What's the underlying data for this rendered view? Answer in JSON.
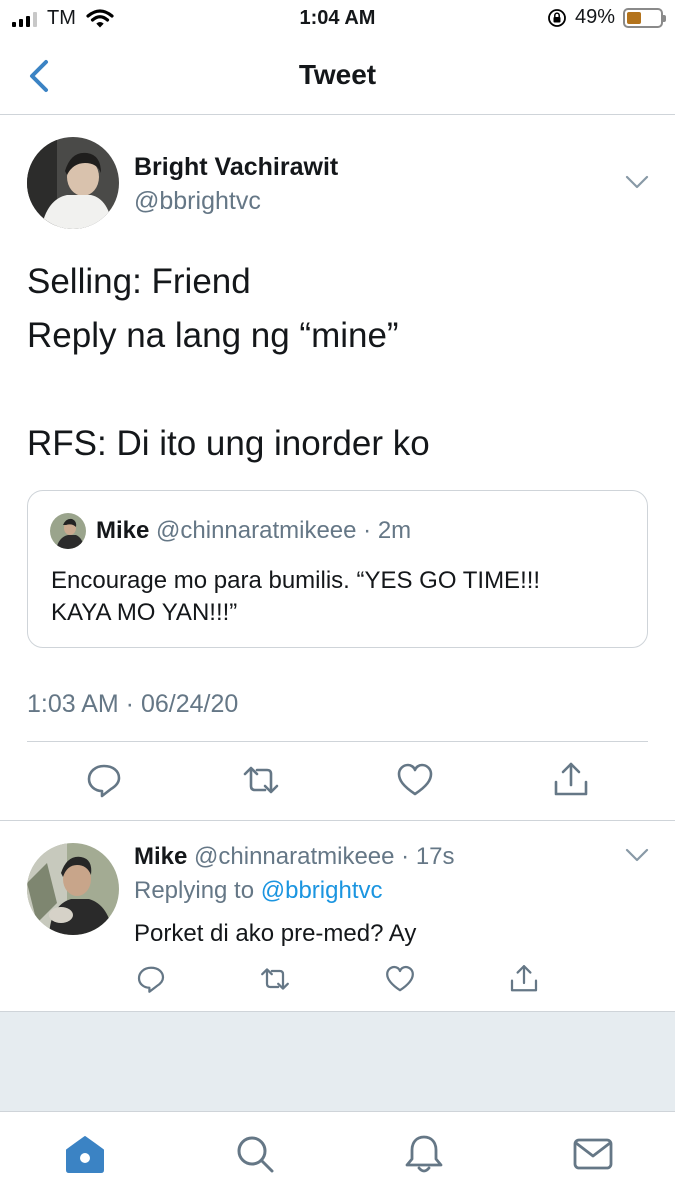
{
  "status_bar": {
    "carrier": "TM",
    "time": "1:04 AM",
    "battery": "49%",
    "battery_level": 0.49,
    "icons": [
      "signal-icon",
      "wifi-icon",
      "orientation-lock-icon",
      "battery-icon"
    ]
  },
  "header": {
    "title": "Tweet",
    "back_icon": "chevron-left-icon"
  },
  "tweet": {
    "author_name": "Bright Vachirawit",
    "author_handle": "@bbrightvc",
    "lines": [
      "Selling: Friend",
      "Reply na lang ng “mine”",
      "RFS: Di ito ung inorder ko"
    ],
    "quote": {
      "name": "Mike",
      "meta": " @chinnaratmikeee · 2m",
      "lines": [
        "Encourage mo para bumilis. “YES GO TIME!!!",
        "KAYA MO YAN!!!”"
      ]
    },
    "timestamp": "1:03 AM · 06/24/20",
    "actions": [
      "reply-icon",
      "retweet-icon",
      "like-icon",
      "share-icon"
    ]
  },
  "reply": {
    "name": "Mike",
    "meta": " @chinnaratmikeee · 17s",
    "replying_prefix": "Replying to ",
    "replying_to": "@bbrightvc",
    "text": "Porket di ako pre-med? Ay"
  },
  "tab_bar": {
    "tabs": [
      "home-icon",
      "search-icon",
      "notifications-icon",
      "messages-icon"
    ]
  },
  "colors": {
    "accent": "#1da1f2",
    "nav_blue": "#3b83c4",
    "secondary_text": "#657786",
    "border": "#cfd4d9",
    "battery": "#b3731c"
  }
}
